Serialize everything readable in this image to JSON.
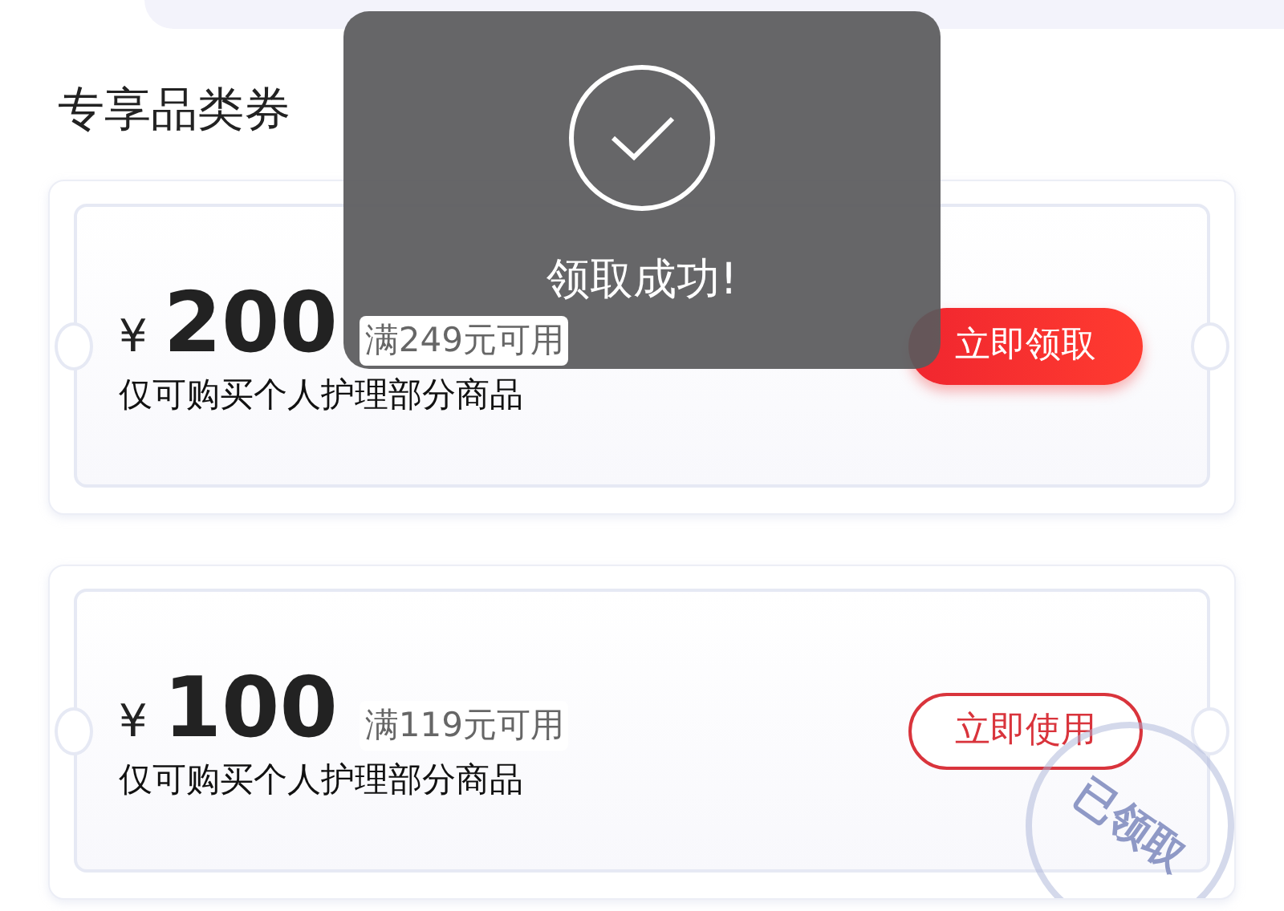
{
  "section_title": "专享品类券",
  "coupons": [
    {
      "currency": "¥",
      "amount": "200",
      "condition": "满249元可用",
      "description": "仅可购买个人护理部分商品",
      "action": {
        "kind": "claim",
        "label": "立即领取"
      },
      "claimed": false
    },
    {
      "currency": "¥",
      "amount": "100",
      "condition": "满119元可用",
      "description": "仅可购买个人护理部分商品",
      "action": {
        "kind": "use",
        "label": "立即使用"
      },
      "claimed": true,
      "stamp_label": "已领取"
    }
  ],
  "toast": {
    "message": "领取成功!"
  }
}
